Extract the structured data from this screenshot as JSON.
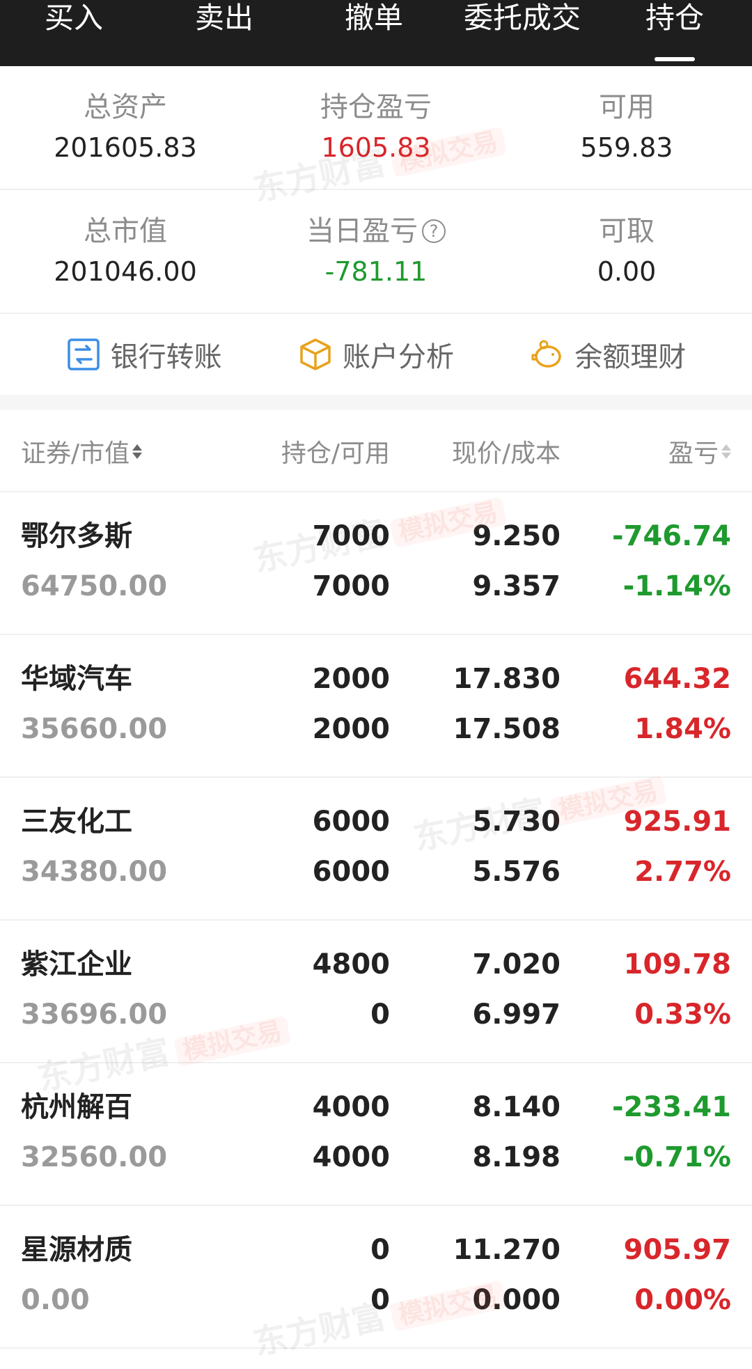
{
  "nav": {
    "tabs": [
      {
        "label": "买入"
      },
      {
        "label": "卖出"
      },
      {
        "label": "撤单"
      },
      {
        "label": "委托成交"
      },
      {
        "label": "持仓"
      }
    ],
    "active": "持仓"
  },
  "summary": {
    "total_assets_label": "总资产",
    "total_assets": "201605.83",
    "position_pl_label": "持仓盈亏",
    "position_pl": "1605.83",
    "available_label": "可用",
    "available": "559.83",
    "market_value_label": "总市值",
    "market_value": "201046.00",
    "daily_pl_label": "当日盈亏",
    "daily_pl": "-781.11",
    "withdrawable_label": "可取",
    "withdrawable": "0.00",
    "help_glyph": "?"
  },
  "actions": [
    {
      "label": "银行转账",
      "icon": "bank-transfer-icon"
    },
    {
      "label": "账户分析",
      "icon": "box-icon"
    },
    {
      "label": "余额理财",
      "icon": "piggy-bank-icon"
    }
  ],
  "table": {
    "headers": {
      "security": "证券/市值",
      "position": "持仓/可用",
      "price": "现价/成本",
      "pl": "盈亏"
    },
    "rows": [
      {
        "name": "鄂尔多斯",
        "market_value": "64750.00",
        "position": "7000",
        "available": "7000",
        "price": "9.250",
        "cost": "9.357",
        "pl": "-746.74",
        "pl_pct": "-1.14%",
        "trend": "down"
      },
      {
        "name": "华域汽车",
        "market_value": "35660.00",
        "position": "2000",
        "available": "2000",
        "price": "17.830",
        "cost": "17.508",
        "pl": "644.32",
        "pl_pct": "1.84%",
        "trend": "up"
      },
      {
        "name": "三友化工",
        "market_value": "34380.00",
        "position": "6000",
        "available": "6000",
        "price": "5.730",
        "cost": "5.576",
        "pl": "925.91",
        "pl_pct": "2.77%",
        "trend": "up"
      },
      {
        "name": "紫江企业",
        "market_value": "33696.00",
        "position": "4800",
        "available": "0",
        "price": "7.020",
        "cost": "6.997",
        "pl": "109.78",
        "pl_pct": "0.33%",
        "trend": "up"
      },
      {
        "name": "杭州解百",
        "market_value": "32560.00",
        "position": "4000",
        "available": "4000",
        "price": "8.140",
        "cost": "8.198",
        "pl": "-233.41",
        "pl_pct": "-0.71%",
        "trend": "down"
      },
      {
        "name": "星源材质",
        "market_value": "0.00",
        "position": "0",
        "available": "0",
        "price": "11.270",
        "cost": "0.000",
        "pl": "905.97",
        "pl_pct": "0.00%",
        "trend": "up"
      }
    ]
  },
  "watermark": {
    "brand": "东方财富",
    "tag": "模拟交易"
  },
  "colors": {
    "up": "#d8262b",
    "down": "#1e9a2e",
    "nav_bg": "#1e1e1e"
  }
}
